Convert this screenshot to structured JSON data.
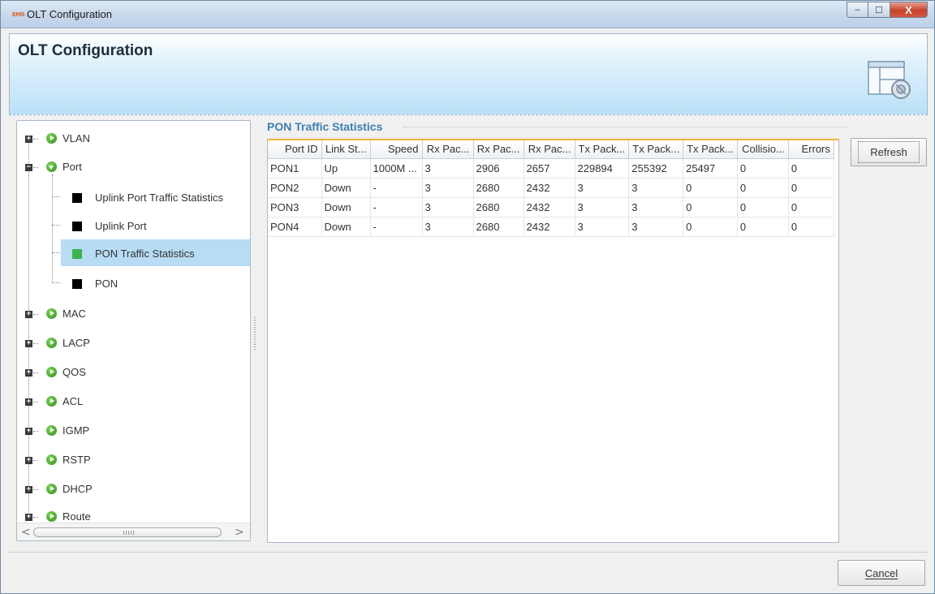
{
  "window": {
    "title": "OLT Configuration",
    "logo_text": "EMS",
    "buttons": {
      "minimize": "–",
      "maximize": "☐",
      "close": "X"
    }
  },
  "banner": {
    "title": "OLT Configuration",
    "icon": "settings-window-icon"
  },
  "tree": {
    "items": [
      {
        "label": "VLAN",
        "expander": "+",
        "expanded": false
      },
      {
        "label": "Port",
        "expander": "−",
        "expanded": true,
        "children": [
          {
            "label": "Uplink Port Traffic Statistics",
            "icon_color": "#000000"
          },
          {
            "label": "Uplink Port",
            "icon_color": "#000000"
          },
          {
            "label": "PON Traffic Statistics",
            "icon_color": "#3ab54a",
            "selected": true
          },
          {
            "label": "PON",
            "icon_color": "#000000"
          }
        ]
      },
      {
        "label": "MAC",
        "expander": "+"
      },
      {
        "label": "LACP",
        "expander": "+"
      },
      {
        "label": "QOS",
        "expander": "+"
      },
      {
        "label": "ACL",
        "expander": "+"
      },
      {
        "label": "IGMP",
        "expander": "+"
      },
      {
        "label": "RSTP",
        "expander": "+"
      },
      {
        "label": "DHCP",
        "expander": "+"
      },
      {
        "label": "Route",
        "expander": "+"
      }
    ],
    "scroll": {
      "left": "<",
      "right": ">"
    }
  },
  "group": {
    "title": "PON Traffic Statistics"
  },
  "table": {
    "columns": [
      "Port ID",
      "Link St...",
      "Speed",
      "Rx Pac...",
      "Rx Pac...",
      "Rx Pac...",
      "Tx Pack...",
      "Tx Pack...",
      "Tx Pack...",
      "Collisio...",
      "Errors"
    ],
    "rows": [
      [
        "PON1",
        "Up",
        "1000M ...",
        "3",
        "2906",
        "2657",
        "229894",
        "255392",
        "25497",
        "0",
        "0"
      ],
      [
        "PON2",
        "Down",
        "-",
        "3",
        "2680",
        "2432",
        "3",
        "3",
        "0",
        "0",
        "0"
      ],
      [
        "PON3",
        "Down",
        "-",
        "3",
        "2680",
        "2432",
        "3",
        "3",
        "0",
        "0",
        "0"
      ],
      [
        "PON4",
        "Down",
        "-",
        "3",
        "2680",
        "2432",
        "3",
        "3",
        "0",
        "0",
        "0"
      ]
    ]
  },
  "buttons": {
    "refresh": "Refresh",
    "cancel": "Cancel"
  },
  "colors": {
    "accent": "#3b7fb3",
    "selection": "#b7dcf4",
    "header_accent": "#f3b23c"
  }
}
